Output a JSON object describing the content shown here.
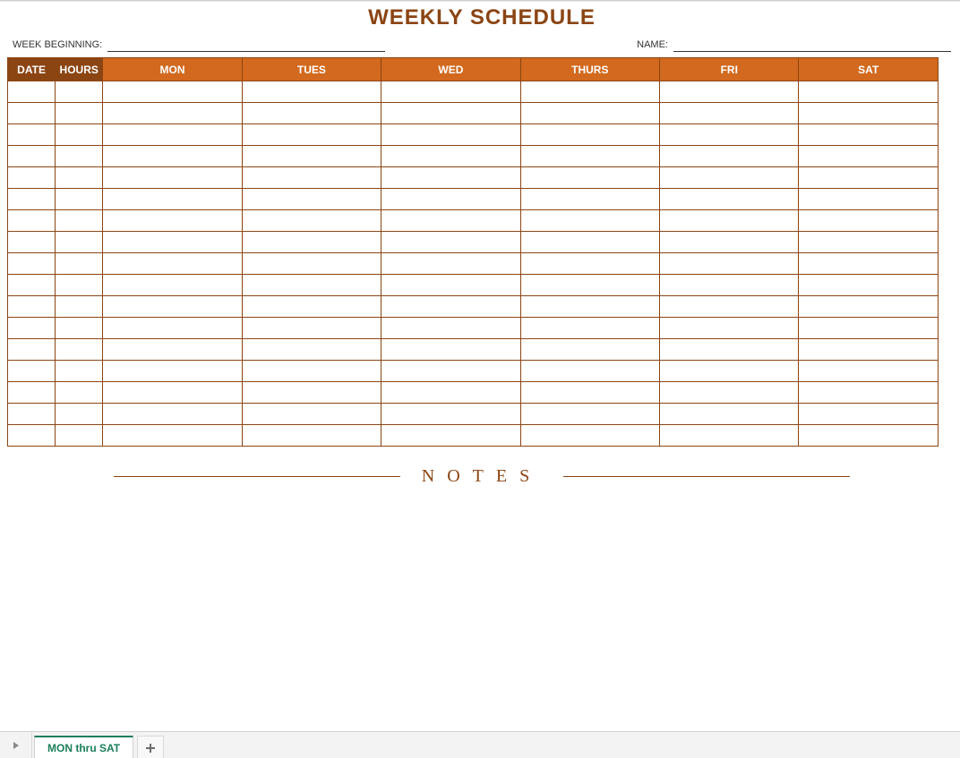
{
  "title": "WEEKLY SCHEDULE",
  "fields": {
    "week_beginning_label": "WEEK BEGINNING:",
    "name_label": "NAME:"
  },
  "columns": {
    "date": "DATE",
    "hours": "HOURS",
    "days": [
      "MON",
      "TUES",
      "WED",
      "THURS",
      "FRI",
      "SAT"
    ]
  },
  "row_count": 17,
  "notes_label": "NOTES",
  "tabbar": {
    "active_tab": "MON thru SAT"
  }
}
